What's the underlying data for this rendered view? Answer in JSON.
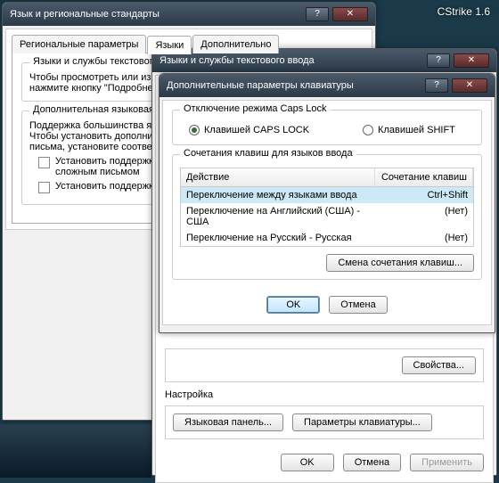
{
  "taskbar": {
    "item": "CStrike 1.6"
  },
  "win1": {
    "title": "Язык и региональные стандарты",
    "tabs": [
      "Региональные параметры",
      "Языки",
      "Дополнительно"
    ],
    "group1_title": "Языки и службы текстового ввода",
    "group1_text1": "Чтобы просмотреть или изменить языки и методы ввода текста, нажмите кнопку \"Подробнее\".",
    "group2_title": "Дополнительная языковая поддержка",
    "group2_text": "Поддержка большинства языков устанавливается по умолчанию. Чтобы установить дополнительные языки со сложными способами письма, установите соответствующий флажок.",
    "chk1": "Установить поддержку языков с письмом справа налево и сложным письмом",
    "chk2": "Установить поддержку языков с письмом иероглифами"
  },
  "win2": {
    "title": "Языки и службы текстового ввода",
    "props_btn": "Свойства...",
    "section": "Настройка",
    "btn_langbar": "Языковая панель...",
    "btn_kbparams": "Параметры клавиатуры...",
    "ok": "OK",
    "cancel": "Отмена",
    "apply": "Применить"
  },
  "win3": {
    "title": "Дополнительные параметры клавиатуры",
    "group_caps": "Отключение режима Caps Lock",
    "radio_caps": "Клавишей CAPS LOCK",
    "radio_shift": "Клавишей SHIFT",
    "group_hot": "Сочетания клавиш для языков ввода",
    "col_action": "Действие",
    "col_combo": "Сочетание клавиш",
    "rows": [
      {
        "action": "Переключение между языками ввода",
        "combo": "Ctrl+Shift"
      },
      {
        "action": "Переключение на Английский (США) - США",
        "combo": "(Нет)"
      },
      {
        "action": "Переключение на Русский - Русская",
        "combo": "(Нет)"
      }
    ],
    "btn_change": "Смена сочетания клавиш...",
    "ok": "OK",
    "cancel": "Отмена"
  }
}
